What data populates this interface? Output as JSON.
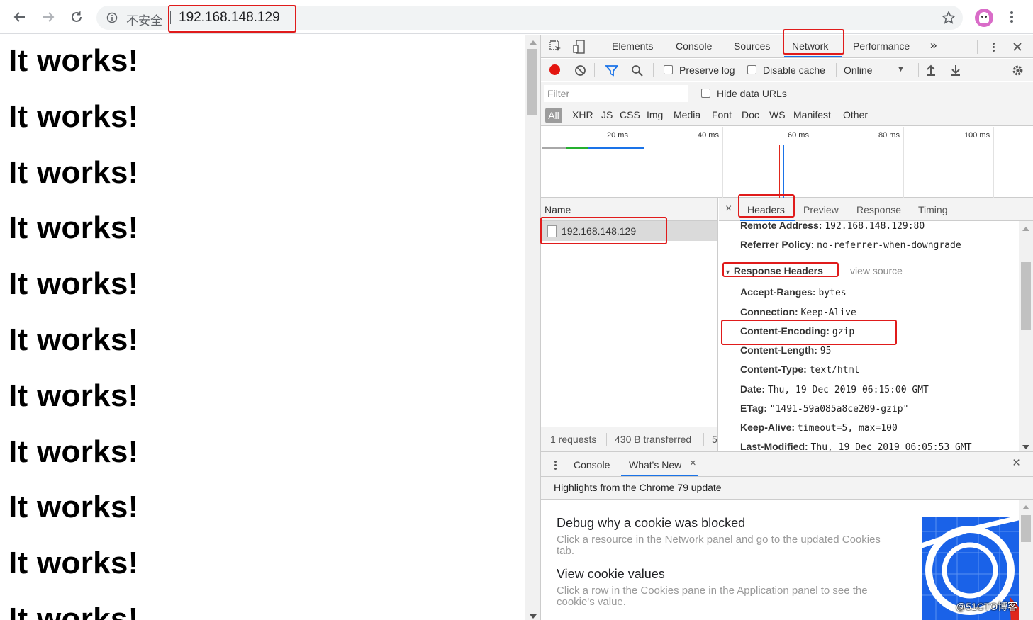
{
  "browser": {
    "insecure_label": "不安全",
    "url": "192.168.148.129"
  },
  "page": {
    "lines": [
      "It works!",
      "It works!",
      "It works!",
      "It works!",
      "It works!",
      "It works!",
      "It works!",
      "It works!",
      "It works!",
      "It works!",
      "It works!"
    ]
  },
  "devtools": {
    "tabs": [
      "Elements",
      "Console",
      "Sources",
      "Network",
      "Performance"
    ],
    "active_tab": "Network",
    "more_tabs": "»",
    "toolbar": {
      "preserve_log": "Preserve log",
      "disable_cache": "Disable cache",
      "throttle": "Online"
    },
    "filter": {
      "placeholder": "Filter",
      "hide_data_urls": "Hide data URLs"
    },
    "types": [
      "All",
      "XHR",
      "JS",
      "CSS",
      "Img",
      "Media",
      "Font",
      "Doc",
      "WS",
      "Manifest",
      "Other"
    ],
    "timeline_labels": [
      "20 ms",
      "40 ms",
      "60 ms",
      "80 ms",
      "100 ms"
    ],
    "names_header": "Name",
    "request_name": "192.168.148.129",
    "status": {
      "requests": "1 requests",
      "transferred": "430 B transferred",
      "more": "5"
    },
    "detail_tabs": [
      "Headers",
      "Preview",
      "Response",
      "Timing"
    ],
    "detail_close": "×",
    "general": [
      {
        "key": "Remote Address:",
        "value": "192.168.148.129:80"
      },
      {
        "key": "Referrer Policy:",
        "value": "no-referrer-when-downgrade"
      }
    ],
    "response_headers_title": "Response Headers",
    "view_source": "view source",
    "response_headers": [
      {
        "key": "Accept-Ranges:",
        "value": "bytes"
      },
      {
        "key": "Connection:",
        "value": "Keep-Alive"
      },
      {
        "key": "Content-Encoding:",
        "value": "gzip"
      },
      {
        "key": "Content-Length:",
        "value": "95"
      },
      {
        "key": "Content-Type:",
        "value": "text/html"
      },
      {
        "key": "Date:",
        "value": "Thu, 19 Dec 2019 06:15:00 GMT"
      },
      {
        "key": "ETag:",
        "value": "\"1491-59a085a8ce209-gzip\""
      },
      {
        "key": "Keep-Alive:",
        "value": "timeout=5, max=100"
      },
      {
        "key": "Last-Modified:",
        "value": "Thu, 19 Dec 2019 06:05:53 GMT"
      }
    ]
  },
  "drawer": {
    "tabs": [
      "Console",
      "What's New"
    ],
    "active_tab": "What's New",
    "tab_close": "×",
    "close": "×",
    "subtitle": "Highlights from the Chrome 79 update",
    "items": [
      {
        "title": "Debug why a cookie was blocked",
        "desc": "Click a resource in the Network panel and go to the updated Cookies tab."
      },
      {
        "title": "View cookie values",
        "desc": "Click a row in the Cookies pane in the Application panel to see the cookie's value."
      }
    ]
  },
  "watermark": "@51CTO博客",
  "colors": {
    "accent": "#1a73e8",
    "record": "#e3150f",
    "annotation": "#e01b1b"
  }
}
